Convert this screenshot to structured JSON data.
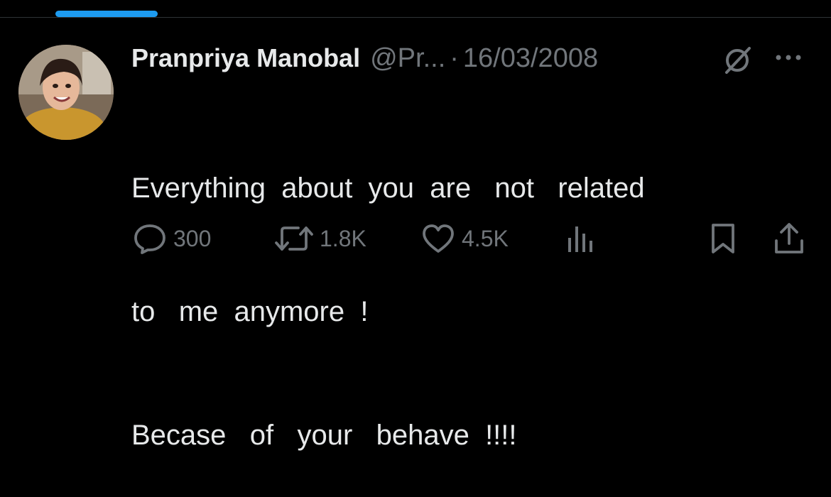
{
  "tweet": {
    "display_name": "Pranpriya Manobal",
    "handle": "@Pr...",
    "separator": "·",
    "date": "16/03/2008",
    "lines": [
      "Everything  about  you  are   not   related",
      "to   me  anymore  !",
      "Becase   of   your   behave  !!!!"
    ]
  },
  "actions": {
    "reply_count": "300",
    "repost_count": "1.8K",
    "like_count": "4.5K"
  },
  "icons": {
    "reply": "speech-bubble-icon",
    "repost": "repost-arrows-icon",
    "like": "heart-icon",
    "views": "bar-chart-icon",
    "bookmark": "bookmark-icon",
    "share": "share-upload-icon",
    "grok": "grok-slash-icon",
    "more": "ellipsis-icon"
  },
  "colors": {
    "background": "#000000",
    "text": "#e7e9ea",
    "muted": "#71767b",
    "accent": "#1d9bf0"
  }
}
